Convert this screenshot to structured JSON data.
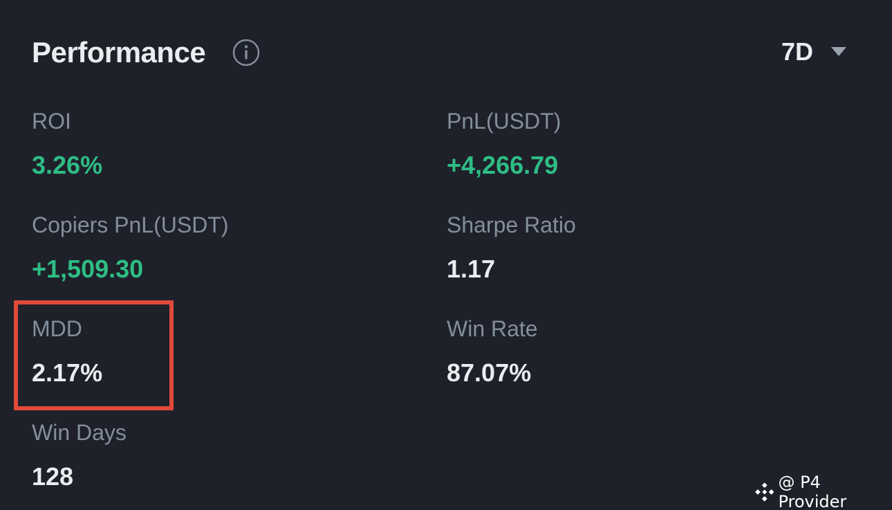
{
  "header": {
    "title": "Performance",
    "period": "7D"
  },
  "metrics": {
    "roi": {
      "label": "ROI",
      "value": "3.26%"
    },
    "pnl": {
      "label": "PnL(USDT)",
      "value": "+4,266.79"
    },
    "copiers_pnl": {
      "label": "Copiers PnL(USDT)",
      "value": "+1,509.30"
    },
    "sharpe": {
      "label": "Sharpe Ratio",
      "value": "1.17"
    },
    "mdd": {
      "label": "MDD",
      "value": "2.17%"
    },
    "win_rate": {
      "label": "Win Rate",
      "value": "87.07%"
    },
    "win_days": {
      "label": "Win Days",
      "value": "128"
    }
  },
  "watermark": {
    "text": "@ P4 Provider"
  },
  "icons": {
    "info": "info-icon",
    "period_dropdown": "caret-down-icon",
    "watermark_logo": "binance-logo-icon"
  },
  "colors": {
    "background": "#1e2129",
    "positive": "#2ebd85",
    "label": "#848e9c",
    "highlight": "#e04a3a"
  }
}
